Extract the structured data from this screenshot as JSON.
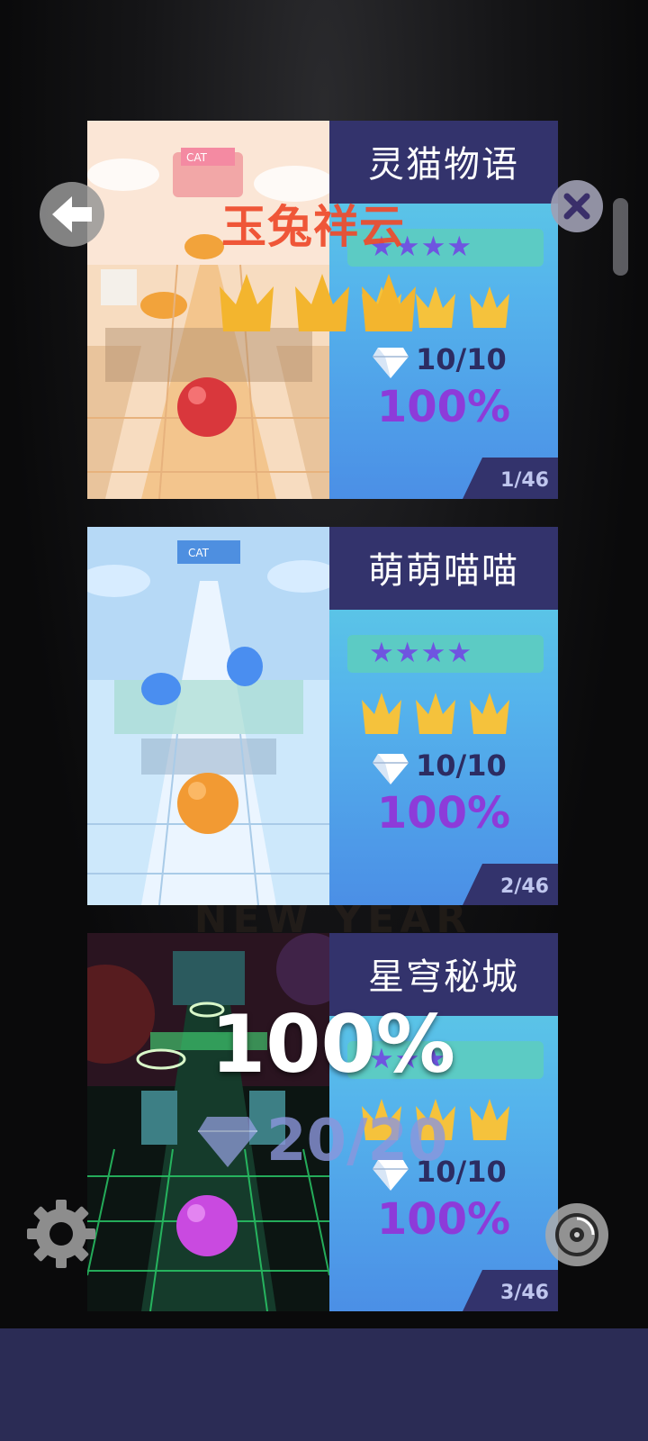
{
  "levels": [
    {
      "name": "灵猫物语",
      "stars_text": "★★★★",
      "stars": 4,
      "crowns": 3,
      "gems": "10/10",
      "percent": "100%",
      "index": "1/46",
      "ball_color": "#d9373c",
      "theme_colors": [
        "#f7d2a8",
        "#f3b56b",
        "#a48a6d"
      ]
    },
    {
      "name": "萌萌喵喵",
      "stars_text": "★★★★",
      "stars": 4,
      "crowns": 3,
      "gems": "10/10",
      "percent": "100%",
      "index": "2/46",
      "ball_color": "#f29a33",
      "theme_colors": [
        "#bfe0fb",
        "#e6f2ff",
        "#8ab3d8"
      ]
    },
    {
      "name": "星穹秘城",
      "stars_text": "★★★",
      "stars": 3,
      "crowns": 3,
      "gems": "10/10",
      "percent": "100%",
      "index": "3/46",
      "ball_color": "#c94ae0",
      "theme_colors": [
        "#0b1a16",
        "#2e8a5e",
        "#53f08a"
      ]
    }
  ],
  "overlay": {
    "level_name": "玉兔祥云",
    "crowns": 4,
    "complete_percent": "100%",
    "gem_total": "20/20"
  },
  "icons": {
    "back": "back-arrow-icon",
    "close": "close-icon",
    "settings": "gear-icon",
    "music": "disc-icon",
    "gem": "diamond-icon",
    "crown": "crown-icon"
  },
  "colors": {
    "title_band": "#33336c",
    "percent": "#8d3bd9",
    "crown": "#f5c23c",
    "bottom_bar": "#2b2c55"
  }
}
